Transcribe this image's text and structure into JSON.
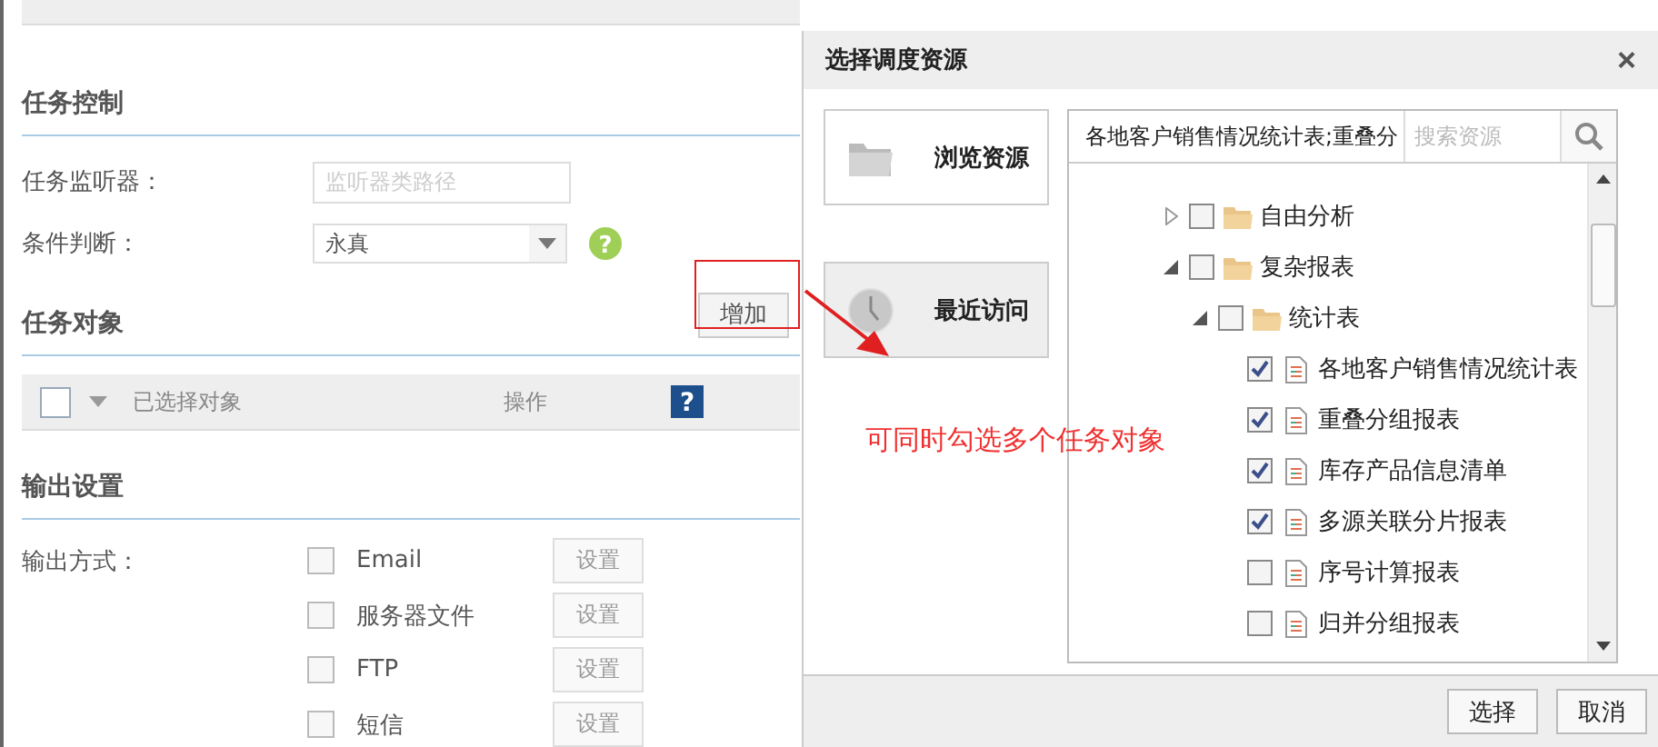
{
  "task_control": {
    "title": "任务控制",
    "listener": {
      "label": "任务监听器：",
      "placeholder": "监听器类路径"
    },
    "condition": {
      "label": "条件判断：",
      "value": "永真",
      "help": "?"
    }
  },
  "task_objects": {
    "title": "任务对象",
    "add_button": "增加",
    "select_all": {
      "checked": false
    },
    "columns": [
      "已选择对象",
      "操作"
    ],
    "help": "?"
  },
  "output": {
    "title": "输出设置",
    "label": "输出方式：",
    "methods": [
      {
        "name": "Email",
        "checked": false,
        "button": "设置"
      },
      {
        "name": "服务器文件",
        "checked": false,
        "button": "设置"
      },
      {
        "name": "FTP",
        "checked": false,
        "button": "设置"
      },
      {
        "name": "短信",
        "checked": false,
        "button": "设置"
      }
    ]
  },
  "dialog": {
    "title": "选择调度资源",
    "close": "×",
    "nav": [
      {
        "label": "浏览资源",
        "kind": "folder",
        "selected": false
      },
      {
        "label": "最近访问",
        "kind": "clock",
        "selected": true
      }
    ],
    "selection": {
      "value": "各地客户销售情况统计表;重叠分"
    },
    "search": {
      "placeholder": "搜索资源"
    },
    "tree": [
      {
        "label": "自由分析",
        "kind": "folder",
        "expanded": false,
        "checked": false
      },
      {
        "label": "复杂报表",
        "kind": "folder",
        "expanded": true,
        "checked": false,
        "children": [
          {
            "label": "统计表",
            "kind": "folder",
            "expanded": true,
            "checked": false,
            "children": [
              {
                "label": "各地客户销售情况统计表",
                "kind": "report",
                "checked": true
              },
              {
                "label": "重叠分组报表",
                "kind": "report",
                "checked": true
              },
              {
                "label": "库存产品信息清单",
                "kind": "report",
                "checked": true
              },
              {
                "label": "多源关联分片报表",
                "kind": "report",
                "checked": true
              },
              {
                "label": "序号计算报表",
                "kind": "report",
                "checked": false
              },
              {
                "label": "归并分组报表",
                "kind": "report",
                "checked": false
              }
            ]
          }
        ]
      }
    ],
    "buttons": [
      "选择",
      "取消"
    ]
  },
  "annotation": {
    "text": "可同时勾选多个任务对象"
  }
}
